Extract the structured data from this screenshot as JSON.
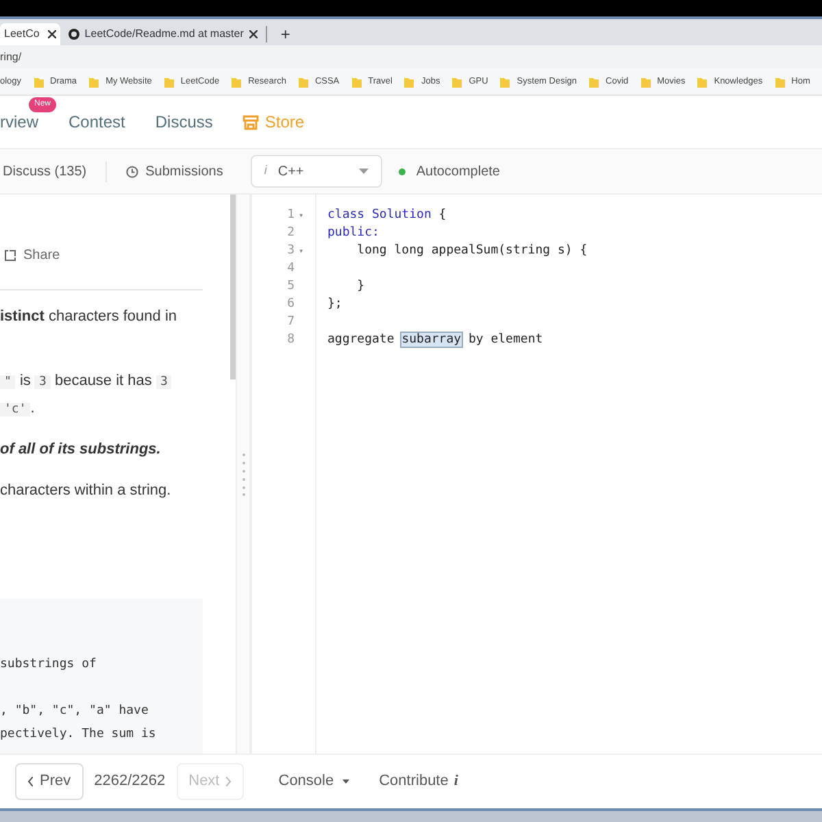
{
  "browser": {
    "tabs": [
      {
        "title": "LeetCo",
        "selected": true
      },
      {
        "title": "LeetCode/Readme.md at master",
        "selected": false
      }
    ],
    "new_tab": "+",
    "address": "ring/",
    "bookmarks": [
      "ology",
      "Drama",
      "My Website",
      "LeetCode",
      "Research",
      "CSSA",
      "Travel",
      "Jobs",
      "GPU",
      "System Design",
      "Covid",
      "Movies",
      "Knowledges",
      "Hom"
    ]
  },
  "nav": {
    "items": [
      {
        "label": "rview",
        "badge": "New",
        "kind": "plain"
      },
      {
        "label": "Contest",
        "kind": "plain"
      },
      {
        "label": "Discuss",
        "kind": "plain"
      },
      {
        "label": "Store",
        "kind": "store"
      }
    ]
  },
  "toolbar": {
    "tabs": [
      {
        "label": "Discuss (135)",
        "kind": "plain"
      },
      {
        "label": "Submissions",
        "kind": "clock"
      }
    ],
    "language": {
      "icon": "i",
      "value": "C++"
    },
    "autocomplete": {
      "label": "Autocomplete",
      "on": true
    }
  },
  "description": {
    "share": "Share",
    "paragraphs": [
      [
        {
          "text": "istinct",
          "kind": "bold"
        },
        {
          "text": " characters found in",
          "kind": "text"
        }
      ],
      [
        {
          "text": "\"",
          "kind": "code"
        },
        {
          "text": " is ",
          "kind": "text"
        },
        {
          "text": "3",
          "kind": "code"
        },
        {
          "text": " because it has ",
          "kind": "text"
        },
        {
          "text": "3",
          "kind": "code"
        }
      ],
      [
        {
          "text": "'c'",
          "kind": "code"
        },
        {
          "text": ".",
          "kind": "text"
        }
      ],
      [
        {
          "text": "of all of its substrings.",
          "kind": "bolditalic"
        }
      ],
      [
        {
          "text": "characters within a string.",
          "kind": "text"
        }
      ]
    ],
    "example_groups": [
      [
        "substrings of"
      ],
      [
        ", \"b\", \"c\", \"a\" have",
        "pectively. The sum is"
      ]
    ]
  },
  "editor": {
    "lines": [
      {
        "number": "1",
        "marker": "▾",
        "tokens": [
          {
            "text": "class Solution",
            "kind": "keyword"
          },
          {
            "text": " {",
            "kind": "plain"
          }
        ]
      },
      {
        "number": "2",
        "tokens": [
          {
            "text": "public:",
            "kind": "keyword"
          }
        ]
      },
      {
        "number": "3",
        "marker": "▾",
        "tokens": [
          {
            "text": "    long long appealSum(string s) {",
            "kind": "plain"
          }
        ]
      },
      {
        "number": "4"
      },
      {
        "number": "5",
        "tokens": [
          {
            "text": "    }",
            "kind": "plain"
          }
        ]
      },
      {
        "number": "6",
        "tokens": [
          {
            "text": "};",
            "kind": "plain"
          }
        ]
      },
      {
        "number": "7"
      },
      {
        "number": "8",
        "tokens": [
          {
            "text": "aggregate ",
            "kind": "plain"
          },
          {
            "text": "subarray",
            "kind": "selected"
          },
          {
            "text": " by element",
            "kind": "plain"
          }
        ]
      }
    ]
  },
  "footer": {
    "prev": {
      "label": "Prev",
      "disabled": false
    },
    "counter": "2262/2262",
    "next": {
      "label": "Next",
      "disabled": true
    },
    "console": "Console",
    "contribute": "Contribute",
    "contribute_icon": "i"
  }
}
